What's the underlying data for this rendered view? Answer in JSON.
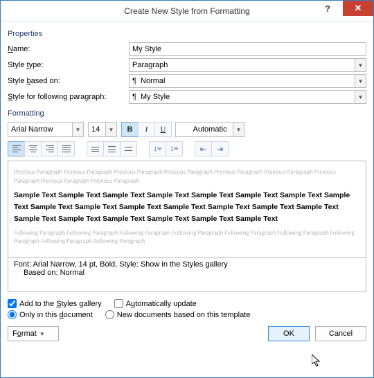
{
  "title": "Create New Style from Formatting",
  "groups": {
    "properties": "Properties",
    "formatting": "Formatting"
  },
  "props": {
    "name_label": "Name:",
    "name_value": "My Style",
    "type_label": "Style type:",
    "type_value": "Paragraph",
    "based_label": "Style based on:",
    "based_value": "Normal",
    "following_label": "Style for following paragraph:",
    "following_value": "My Style"
  },
  "format": {
    "font_name": "Arial Narrow",
    "font_size": "14",
    "color": "Automatic"
  },
  "preview": {
    "before": "Previous Paragraph Previous Paragraph Previous Paragraph Previous Paragraph Previous Paragraph Previous Paragraph Previous Paragraph Previous Paragraph Previous Paragraph",
    "sample": "Sample Text Sample Text Sample Text Sample Text Sample Text Sample Text Sample Text Sample Text Sample Text Sample Text Sample Text Sample Text Sample Text Sample Text Sample Text Sample Text Sample Text Sample Text Sample Text Sample Text Sample Text",
    "after": "Following Paragraph Following Paragraph Following Paragraph Following Paragraph Following Paragraph Following Paragraph Following Paragraph Following Paragraph Following Paragraph"
  },
  "description": {
    "line1": "Font: Arial Narrow, 14 pt, Bold, Style: Show in the Styles gallery",
    "line2": "Based on: Normal"
  },
  "checks": {
    "add_gallery": "Add to the Styles gallery",
    "auto_update": "Automatically update",
    "only_doc": "Only in this document",
    "new_docs": "New documents based on this template"
  },
  "buttons": {
    "format": "Format",
    "ok": "OK",
    "cancel": "Cancel"
  }
}
